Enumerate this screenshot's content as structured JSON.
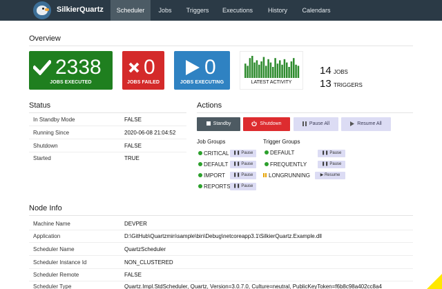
{
  "navbar": {
    "brand": "SilkierQuartz",
    "items": [
      {
        "label": "Scheduler",
        "active": true
      },
      {
        "label": "Jobs"
      },
      {
        "label": "Triggers"
      },
      {
        "label": "Executions"
      },
      {
        "label": "History"
      },
      {
        "label": "Calendars"
      }
    ]
  },
  "overview": {
    "title": "Overview",
    "tiles": [
      {
        "value": "2338",
        "label": "JOBS EXECUTED",
        "color": "#1f7f1f",
        "icon": "checkmark-icon"
      },
      {
        "value": "0",
        "label": "JOBS FAILED",
        "color": "#d42a2a",
        "icon": "x-icon"
      },
      {
        "value": "0",
        "label": "JOBS EXECUTING",
        "color": "#2f82c2",
        "icon": "play-icon"
      }
    ],
    "activity": {
      "label": "LATEST ACTIVITY",
      "bar_color": "#2e8b2e",
      "bars": [
        0.65,
        0.55,
        0.9,
        1.0,
        0.7,
        0.8,
        0.6,
        0.75,
        0.95,
        0.55,
        0.85,
        0.7,
        0.5,
        0.9,
        0.65,
        0.8,
        0.6,
        0.85,
        0.7,
        0.5,
        0.75,
        0.9,
        0.6,
        0.55
      ]
    },
    "counts": {
      "jobs_num": "14",
      "jobs_label": "JOBS",
      "triggers_num": "13",
      "triggers_label": "TRIGGERS"
    }
  },
  "status": {
    "title": "Status",
    "rows": [
      {
        "label": "In Standby Mode",
        "value": "FALSE"
      },
      {
        "label": "Running Since",
        "value": "2020-06-08 21:04:52"
      },
      {
        "label": "Shutdown",
        "value": "FALSE"
      },
      {
        "label": "Started",
        "value": "TRUE"
      }
    ]
  },
  "actions": {
    "title": "Actions",
    "standby": "Standby",
    "shutdown": "Shutdown",
    "pause_all": "Pause All",
    "resume_all": "Resume All",
    "job_groups_title": "Job Groups",
    "trigger_groups_title": "Trigger Groups",
    "pause_label": "Pause",
    "resume_label": "Resume",
    "job_groups": [
      "CRITICAL",
      "DEFAULT",
      "IMPORT",
      "REPORTS"
    ],
    "trigger_groups": [
      {
        "name": "DEFAULT",
        "state": "running"
      },
      {
        "name": "FREQUENTLY",
        "state": "running"
      },
      {
        "name": "LONGRUNNING",
        "state": "paused"
      }
    ]
  },
  "node_info": {
    "title": "Node Info",
    "rows": [
      {
        "label": "Machine Name",
        "value": "DEVPER"
      },
      {
        "label": "Application",
        "value": "D:\\GitHub\\Quartzmin\\sample\\bin\\Debug\\netcoreapp3.1\\SilkierQuartz.Example.dll"
      },
      {
        "label": "Scheduler Name",
        "value": "QuartzScheduler"
      },
      {
        "label": "Scheduler Instance Id",
        "value": "NON_CLUSTERED"
      },
      {
        "label": "Scheduler Remote",
        "value": "FALSE"
      },
      {
        "label": "Scheduler Type",
        "value": "Quartz.Impl.StdScheduler, Quartz, Version=3.0.7.0, Culture=neutral, PublicKeyToken=f6b8c98a402cc8a4"
      }
    ]
  }
}
